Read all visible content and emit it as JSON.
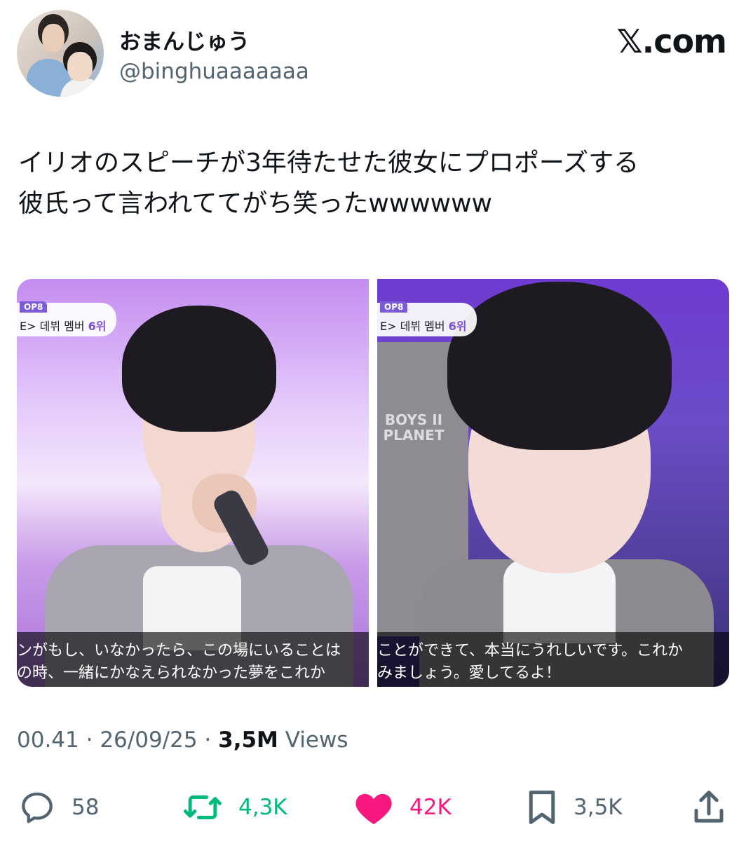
{
  "profile": {
    "display_name": "おまんじゅう",
    "handle": "@binghuaaaaaaa",
    "brand": "𝕏.com"
  },
  "tweet": {
    "line1": "イリオのスピーチが3年待たせた彼女にプロポーズする",
    "line2": "彼氏って言われててがち笑ったwwwwww"
  },
  "media": {
    "left": {
      "tag_top": "OP8",
      "tag_sub_prefix": "E> 데뷔 멤버 ",
      "tag_sub_rank": "6위",
      "subtitle_line1": "ンがもし、いなかったら、この場にいることは",
      "subtitle_line2": "の時、一緒にかなえられなかった夢をこれか"
    },
    "right": {
      "tag_top": "OP8",
      "tag_sub_prefix": "E> 데뷔 멤버 ",
      "tag_sub_rank": "6위",
      "logo_text": "BOYS II PLANET",
      "subtitle_line1": "ことができて、本当にうれしいです。これか",
      "subtitle_line2": "みましょう。愛してるよ！"
    }
  },
  "meta": {
    "time": "00.41",
    "separator": "·",
    "date": "26/09/25",
    "views_count": "3,5M",
    "views_label": "Views"
  },
  "actions": {
    "replies": "58",
    "reposts": "4,3K",
    "likes": "42K",
    "bookmarks": "3,5K"
  },
  "colors": {
    "repost_green": "#00ba7c",
    "like_pink": "#f91880",
    "secondary_text": "#536471",
    "primary_text": "#0f1419"
  }
}
